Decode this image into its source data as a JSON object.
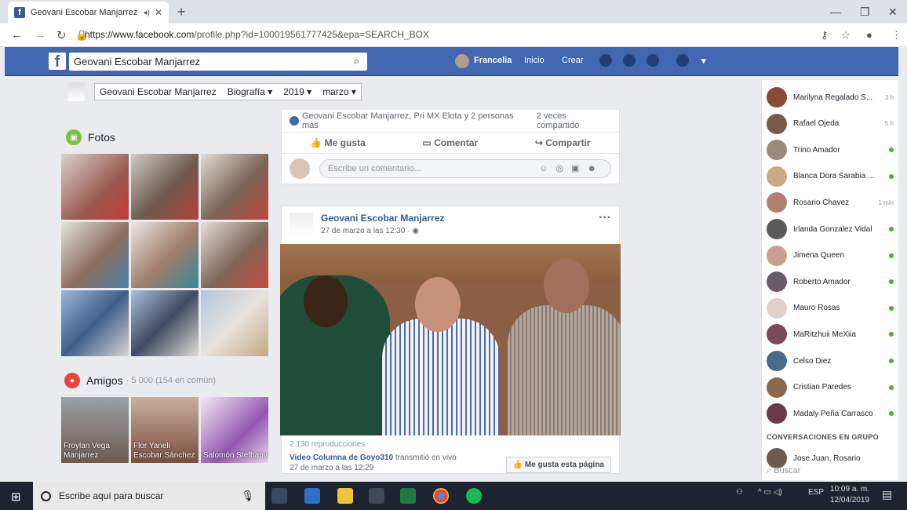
{
  "browser": {
    "tab_title": "Geovani Escobar Manjarrez",
    "url_host": "https://www.facebook.com",
    "url_path": "/profile.php?id=100019561777425&epa=SEARCH_BOX"
  },
  "fb": {
    "search_value": "Geovani Escobar Manjarrez",
    "user_name": "Francelia",
    "nav_home": "Inicio",
    "nav_create": "Crear"
  },
  "profile_bar": {
    "name": "Geovani Escobar Manjarrez",
    "section": "Biografía",
    "year": "2019",
    "month": "marzo"
  },
  "left": {
    "photos_label": "Fotos",
    "friends_label": "Amigos",
    "friends_count": "· 5 000 (154 en común)",
    "friends": [
      "Froylan Vega Manjarrez",
      "Flor Yaneli Escobar Sánchez",
      "Salomón Stefhany"
    ]
  },
  "post_prev": {
    "shared_by": "Geovani Escobar Manjarrez, Pri MX Elota y 2 personas más",
    "share_count": "2 veces compartido",
    "like": "Me gusta",
    "comment": "Comentar",
    "share": "Compartir",
    "comment_placeholder": "Escribe un comentario..."
  },
  "post": {
    "author": "Geovani Escobar Manjarrez",
    "time": "27 de marzo a las 12:30",
    "views": "2.130 reproducciones",
    "video_source": "Video Columna de Goyo310",
    "video_action": "transmitió en vivo",
    "video_time": "27 de marzo a las 12:29",
    "like_page": "Me gusta esta página"
  },
  "chat": {
    "contacts": [
      {
        "name": "Marilyna Regalado S...",
        "status": "3 h",
        "online": false
      },
      {
        "name": "Rafael Ojeda",
        "status": "5 h",
        "online": false
      },
      {
        "name": "Trino Amador",
        "status": "",
        "online": true
      },
      {
        "name": "Blanca Dora Sarabia ...",
        "status": "",
        "online": true
      },
      {
        "name": "Rosario Chavez",
        "status": "1 min",
        "online": false
      },
      {
        "name": "Irlanda Gonzalez Vidal",
        "status": "",
        "online": true
      },
      {
        "name": "Jimena Queen",
        "status": "",
        "online": true
      },
      {
        "name": "Roberto Amador",
        "status": "",
        "online": true
      },
      {
        "name": "Mauro Rosas",
        "status": "",
        "online": true
      },
      {
        "name": "MaRitzhuii MeXiia",
        "status": "",
        "online": true
      },
      {
        "name": "Celso Diez",
        "status": "",
        "online": true
      },
      {
        "name": "Cristian Paredes",
        "status": "",
        "online": true
      },
      {
        "name": "Madaly Peña Carrasco",
        "status": "",
        "online": true
      }
    ],
    "group_header": "CONVERSACIONES EN GRUPO",
    "group_item": "Jose Juan, Rosario",
    "search_placeholder": "Buscar"
  },
  "taskbar": {
    "search_text": "Escribe aquí para buscar",
    "lang": "ESP",
    "time": "10:09 a. m.",
    "date": "12/04/2019"
  },
  "colors": {
    "fb_blue": "#4267b2",
    "link": "#365899",
    "online": "#42b72a"
  }
}
